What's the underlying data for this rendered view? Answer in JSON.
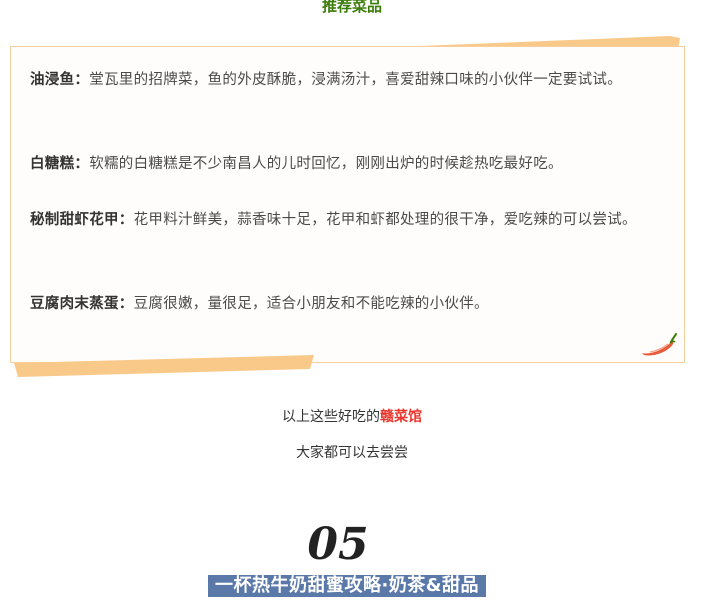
{
  "section_title": "推荐菜品",
  "dishes": [
    {
      "name": "油浸鱼：",
      "desc": "堂瓦里的招牌菜，鱼的外皮酥脆，浸满汤汁，喜爱甜辣口味的小伙伴一定要试试。"
    },
    {
      "name": "白糖糕：",
      "desc": "软糯的白糖糕是不少南昌人的儿时回忆，刚刚出炉的时候趁热吃最好吃。"
    },
    {
      "name": "秘制甜虾花甲：",
      "desc": "花甲料汁鲜美，蒜香味十足，花甲和虾都处理的很干净，爱吃辣的可以尝试。"
    },
    {
      "name": "豆腐肉末蒸蛋：",
      "desc": "豆腐很嫩，量很足，适合小朋友和不能吃辣的小伙伴。"
    }
  ],
  "summary": {
    "line1_prefix": "以上这些好吃的",
    "line1_highlight": "赣菜馆",
    "line2": "大家都可以去尝尝"
  },
  "next_section": {
    "number": "05",
    "banner": "一杯热牛奶甜蜜攻略·奶茶&甜品"
  },
  "colors": {
    "title_green": "#3c7d0a",
    "tape_orange": "#f9c98a",
    "border": "#f6cf9c",
    "highlight_red": "#e8362c",
    "banner_blue": "#5a78a8"
  },
  "icons": {
    "decoration": "chili-pepper-icon"
  }
}
